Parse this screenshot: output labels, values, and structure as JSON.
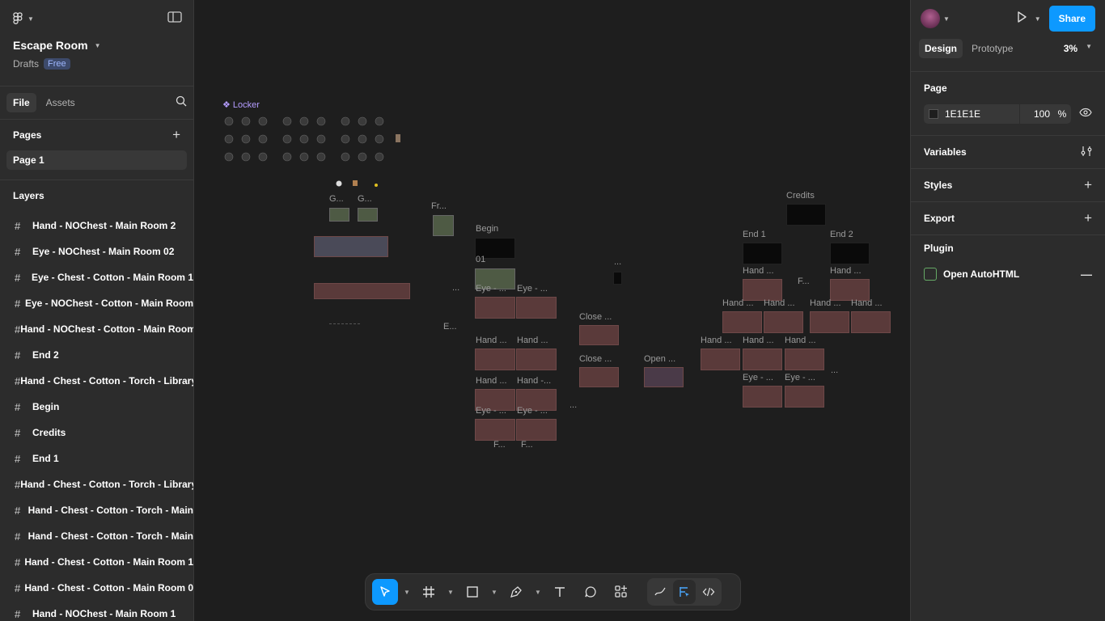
{
  "file": {
    "title": "Escape Room",
    "location": "Drafts",
    "plan_badge": "Free"
  },
  "left_tabs": {
    "file": "File",
    "assets": "Assets"
  },
  "pages": {
    "header": "Pages",
    "items": [
      "Page 1"
    ]
  },
  "layers": {
    "header": "Layers",
    "items": [
      "Hand - NOChest - Main Room 2",
      "Eye - NOChest - Main Room 02",
      "Eye - Chest - Cotton - Main Room 1",
      "Eye - NOChest - Cotton - Main Room",
      "Hand - NOChest - Cotton - Main Room",
      "End 2",
      "Hand - Chest - Cotton - Torch - Library",
      "Begin",
      "Credits",
      "End 1",
      "Hand - Chest - Cotton - Torch - Library",
      "Hand - Chest - Cotton - Torch - Main",
      "Hand - Chest - Cotton - Torch - Main",
      "Hand - Chest - Cotton - Main Room 1",
      "Hand - Chest - Cotton - Main Room 0",
      "Hand - NOChest - Main Room 1"
    ]
  },
  "canvas": {
    "component_label": "Locker",
    "labels": {
      "g1": "G...",
      "g2": "G...",
      "fr": "Fr...",
      "begin": "Begin",
      "n01": "01",
      "eye1": "Eye - ...",
      "eye2": "Eye - ...",
      "hand1": "Hand ...",
      "hand2": "Hand ...",
      "hand3": "Hand ...",
      "hand4": "Hand -...",
      "eye3": "Eye - ...",
      "eye4": "Eye - ...",
      "close1": "Close ...",
      "close2": "Close ...",
      "open": "Open ...",
      "e": "E...",
      "credits": "Credits",
      "end1": "End 1",
      "end2": "End 2",
      "rh1": "Hand ...",
      "rh2": "Hand ...",
      "rf": "F...",
      "rh3": "Hand ...",
      "rh4": "Hand ...",
      "rh5": "Hand ...",
      "rh6": "Hand ...",
      "rh7": "Hand ...",
      "rh8": "Hand ...",
      "rh9": "Hand ...",
      "re1": "Eye - ...",
      "re2": "Eye - ...",
      "f1": "F...",
      "f2": "F...",
      "dots1": "...",
      "dots2": "...",
      "dots3": "...",
      "dots4": "..."
    }
  },
  "toolbar": {
    "tools": [
      "move-tool",
      "frame-tool",
      "shape-tool",
      "pen-tool",
      "text-tool",
      "comment-tool",
      "actions-tool"
    ],
    "modes": [
      "draw-mode",
      "design-mode",
      "dev-mode"
    ]
  },
  "right": {
    "share": "Share",
    "tabs": {
      "design": "Design",
      "prototype": "Prototype"
    },
    "zoom": "3%",
    "page_section": "Page",
    "page_color": "1E1E1E",
    "page_opacity": "100",
    "opacity_unit": "%",
    "variables": "Variables",
    "styles": "Styles",
    "export": "Export",
    "plugin_section": "Plugin",
    "plugin_name": "Open AutoHTML"
  },
  "help": "?",
  "colors": {
    "accent": "#0d99ff",
    "canvas": "#1e1e1e",
    "panel": "#2c2c2c",
    "component": "#b49cff"
  }
}
